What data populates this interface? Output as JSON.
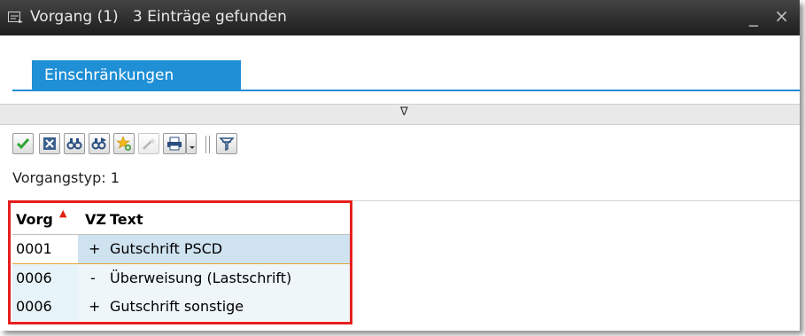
{
  "window": {
    "title": "Vorgang (1)   3 Einträge gefunden",
    "minimize_glyph": "_",
    "close_glyph": "×"
  },
  "tabs": [
    {
      "label": "Einschränkungen",
      "active": true
    }
  ],
  "collapse_glyph": "∇",
  "toolbar": {
    "icons": [
      "check-icon",
      "cancel-icon",
      "find-icon",
      "find-next-icon",
      "favorite-add-icon",
      "magic-wand-icon",
      "print-icon",
      "dropdown-icon",
      "filter-icon"
    ]
  },
  "filter_info": "Vorgangstyp: 1",
  "table": {
    "columns": [
      "Vorg",
      "VZ",
      "Text"
    ],
    "rows": [
      {
        "vorg": "0001",
        "vz": "+",
        "text": "Gutschrift PSCD"
      },
      {
        "vorg": "0006",
        "vz": "-",
        "text": "Überweisung (Lastschrift)"
      },
      {
        "vorg": "0006",
        "vz": "+",
        "text": "Gutschrift sonstige"
      }
    ]
  },
  "colors": {
    "accent": "#1f8fd6",
    "highlight_box": "#e51f1f",
    "selected_row": "#cfe2f0"
  }
}
